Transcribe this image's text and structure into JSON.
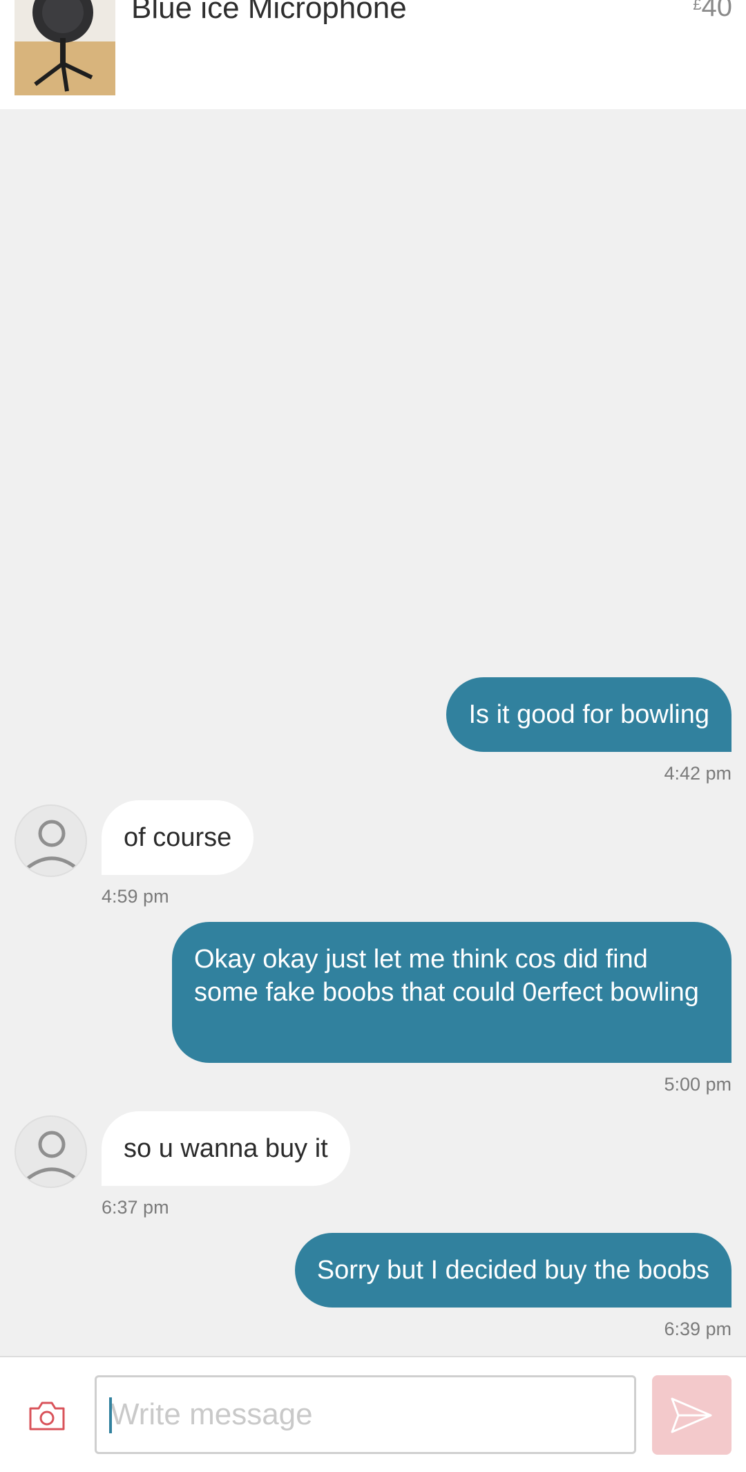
{
  "header": {
    "product_title": "Blue ice Microphone",
    "price_currency": "£",
    "price_amount": "40"
  },
  "messages": [
    {
      "direction": "out",
      "text": "Is it good for bowling",
      "time": "4:42 pm"
    },
    {
      "direction": "in",
      "text": "of course",
      "time": "4:59 pm"
    },
    {
      "direction": "out",
      "text": "Okay okay just let me think cos did find some fake boobs that could 0erfect bowling",
      "time": "5:00 pm"
    },
    {
      "direction": "in",
      "text": "so u wanna buy it",
      "time": "6:37 pm"
    },
    {
      "direction": "out",
      "text": "Sorry but I decided buy the boobs",
      "time": "6:39 pm"
    }
  ],
  "composer": {
    "placeholder": "Write message",
    "value": ""
  },
  "icons": {
    "camera": "camera-icon",
    "send": "send-icon",
    "avatar": "user-avatar-icon"
  },
  "colors": {
    "outgoing_bubble": "#31819e",
    "incoming_bubble": "#ffffff",
    "send_button": "#f3c9cb",
    "camera_icon": "#d9535a"
  }
}
